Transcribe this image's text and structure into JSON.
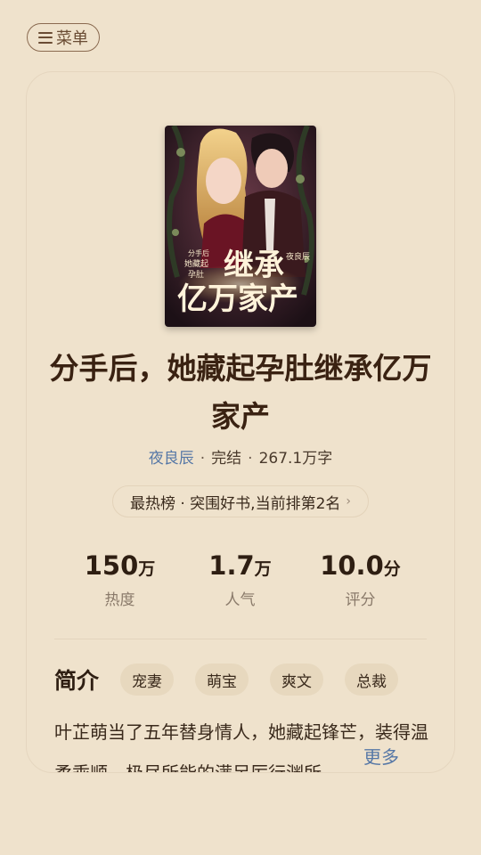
{
  "menu": {
    "label": "菜单"
  },
  "book": {
    "title": "分手后，她藏起孕肚继承亿万家产",
    "author": "夜良辰",
    "status": "完结",
    "word_count": "267.1万字",
    "cover_text": {
      "top_small": "分手后",
      "middle_small_1": "她藏起",
      "middle_small_2": "孕肚",
      "big_1": "继承",
      "big_2": "亿万家产",
      "author_mark": "夜良辰"
    }
  },
  "rank": {
    "label": "最热榜 · 突围好书,当前排第2名"
  },
  "stats": [
    {
      "value": "150",
      "unit": "万",
      "label": "热度"
    },
    {
      "value": "1.7",
      "unit": "万",
      "label": "人气"
    },
    {
      "value": "10.0",
      "unit": "分",
      "label": "评分"
    }
  ],
  "intro": {
    "heading": "简介",
    "tags": [
      "宠妻",
      "萌宝",
      "爽文",
      "总裁"
    ],
    "text": "叶芷萌当了五年替身情人，她藏起锋芒，装得温柔乖顺，极尽所能的满足厉行渊所",
    "more_label": "更多"
  },
  "colors": {
    "background": "#efe2cc",
    "accent_link": "#5577a6",
    "tag_bg": "#e7d8be"
  }
}
